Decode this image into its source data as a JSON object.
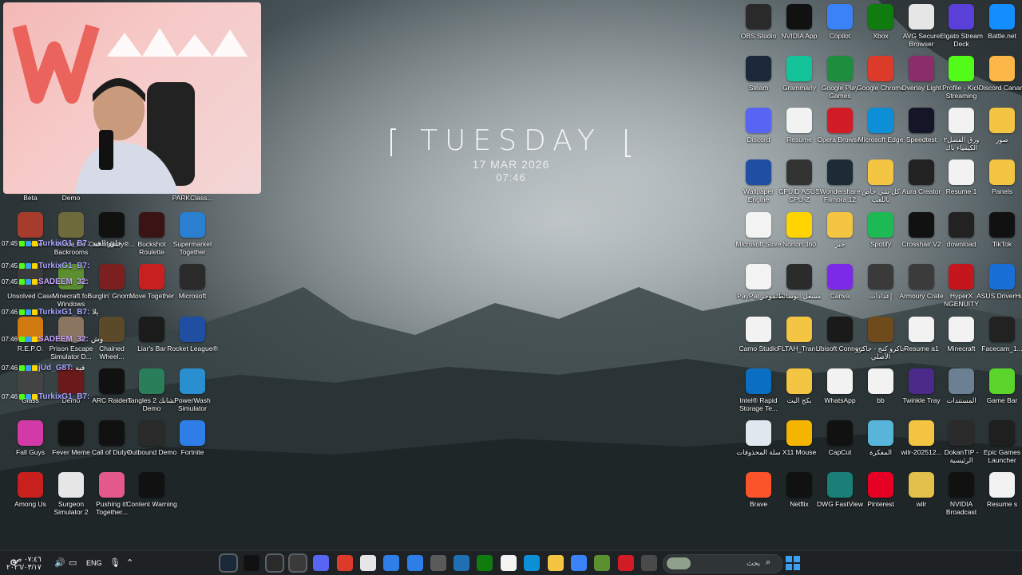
{
  "wallpaper": {
    "day": "TUESDAY",
    "date": "17 MAR 2026",
    "time": "07:46"
  },
  "desktop_icons_right": [
    {
      "label": "OBS Studio",
      "icon": "obs-icon",
      "color": "#2a2a2a"
    },
    {
      "label": "NVIDIA App",
      "icon": "nvidia-icon",
      "color": "#111111"
    },
    {
      "label": "Copilot",
      "icon": "copilot-icon",
      "color": "#3b82f6"
    },
    {
      "label": "Xbox",
      "icon": "xbox-icon",
      "color": "#107c10"
    },
    {
      "label": "AVG Secure Browser",
      "icon": "avg-browser-icon",
      "color": "#e6e6e6"
    },
    {
      "label": "Elgato Stream Deck",
      "icon": "stream-deck-icon",
      "color": "#5b3fd9"
    },
    {
      "label": "Battle.net",
      "icon": "battlenet-icon",
      "color": "#148eff"
    },
    {
      "label": "Steam",
      "icon": "steam-icon",
      "color": "#1b2838"
    },
    {
      "label": "Grammarly",
      "icon": "grammarly-icon",
      "color": "#15c39a"
    },
    {
      "label": "Google Play Games",
      "icon": "play-games-icon",
      "color": "#1e8e3e"
    },
    {
      "label": "Google Chrome",
      "icon": "chrome-icon",
      "color": "#dd3b2a"
    },
    {
      "label": "Overlay Light",
      "icon": "winrar-icon",
      "color": "#8b2d6b"
    },
    {
      "label": "Profile - Kick Streaming",
      "icon": "kick-icon",
      "color": "#53fc18"
    },
    {
      "label": "Discord Canary",
      "icon": "discord-canary-icon",
      "color": "#fbb848"
    },
    {
      "label": "Discord",
      "icon": "discord-icon",
      "color": "#5865f2"
    },
    {
      "label": "Resume",
      "icon": "document-icon",
      "color": "#f2f2f2"
    },
    {
      "label": "Opera Browser",
      "icon": "opera-icon",
      "color": "#d11b25"
    },
    {
      "label": "Microsoft Edge",
      "icon": "edge-icon",
      "color": "#0c8fd6"
    },
    {
      "label": "Speedtest",
      "icon": "speedtest-icon",
      "color": "#141526"
    },
    {
      "label": "ورق الفصل٢ الكيمياء باك",
      "icon": "pdf-icon",
      "color": "#f2f2f2"
    },
    {
      "label": "صور",
      "icon": "folder-icon",
      "color": "#f4c542"
    },
    {
      "label": "Wallpaper Engine",
      "icon": "wallpaper-engine-icon",
      "color": "#1f4ea3"
    },
    {
      "label": "CPUID ASUS CPU-Z",
      "icon": "cpuz-icon",
      "color": "#333333"
    },
    {
      "label": "Wondershare Filmora 12",
      "icon": "filmora-icon",
      "color": "#1d2b36"
    },
    {
      "label": "كل شي خاص باللعب",
      "icon": "folder-icon",
      "color": "#f4c542"
    },
    {
      "label": "Aura Creator",
      "icon": "aura-icon",
      "color": "#222222"
    },
    {
      "label": "Resume 1",
      "icon": "document-icon",
      "color": "#f2f2f2"
    },
    {
      "label": "Panels",
      "icon": "folder-icon",
      "color": "#f4c542"
    },
    {
      "label": "Microsoft Store",
      "icon": "store-icon",
      "color": "#f3f3f3"
    },
    {
      "label": "Norton 360",
      "icon": "norton-icon",
      "color": "#ffd400"
    },
    {
      "label": "جبر",
      "icon": "folder-icon",
      "color": "#f4c542"
    },
    {
      "label": "Spotify",
      "icon": "spotify-icon",
      "color": "#1db954"
    },
    {
      "label": "Crosshair V2",
      "icon": "crosshair-icon",
      "color": "#111111"
    },
    {
      "label": "download",
      "icon": "file-icon",
      "color": "#222222"
    },
    {
      "label": "TikTok",
      "icon": "tiktok-icon",
      "color": "#111111"
    },
    {
      "label": "PayPal الموجز",
      "icon": "paypal-icon",
      "color": "#f3f3f3"
    },
    {
      "label": "مشغل الوسائط",
      "icon": "media-player-icon",
      "color": "#2b2b2b"
    },
    {
      "label": "Canva",
      "icon": "canva-icon",
      "color": "#7d2ae8"
    },
    {
      "label": "إعدادات",
      "icon": "settings-icon",
      "color": "#3a3a3a"
    },
    {
      "label": "Armoury Crate",
      "icon": "armoury-icon",
      "color": "#3b3b3b"
    },
    {
      "label": "HyperX NGENUITY",
      "icon": "hyperx-icon",
      "color": "#c5161d"
    },
    {
      "label": "ASUS DriverHub",
      "icon": "asus-driverhub-icon",
      "color": "#1a6fd6"
    },
    {
      "label": "Camo Studio",
      "icon": "document-icon",
      "color": "#f2f2f2"
    },
    {
      "label": "FLTAH_Tran...",
      "icon": "zip-folder-icon",
      "color": "#f4c542"
    },
    {
      "label": "Ubisoft Connect",
      "icon": "ubisoft-icon",
      "color": "#1a1a1a"
    },
    {
      "label": "جاكرو كنج - جاكرو الأصلي",
      "icon": "game-icon",
      "color": "#6f4a1c"
    },
    {
      "label": "Resume a1",
      "icon": "document-icon",
      "color": "#f2f2f2"
    },
    {
      "label": "Minecraft",
      "icon": "document-icon",
      "color": "#f2f2f2"
    },
    {
      "label": "Facecam_1...",
      "icon": "file-icon",
      "color": "#222222"
    },
    {
      "label": "Intel® Rapid Storage Te...",
      "icon": "intel-icon",
      "color": "#0a6fc2"
    },
    {
      "label": "بكج البث",
      "icon": "folder-icon",
      "color": "#f4c542"
    },
    {
      "label": "WhatsApp",
      "icon": "document-icon",
      "color": "#f2f2f2"
    },
    {
      "label": "bb",
      "icon": "pdf-icon",
      "color": "#f2f2f2"
    },
    {
      "label": "Twinkle Tray",
      "icon": "twinkle-icon",
      "color": "#4b2a8a"
    },
    {
      "label": "المستندات",
      "icon": "documents-folder-icon",
      "color": "#6d7f93"
    },
    {
      "label": "Game Bar",
      "icon": "game-bar-icon",
      "color": "#5bd42b"
    },
    {
      "label": "سلة المحذوفات",
      "icon": "recycle-bin-icon",
      "color": "#dfe8ef"
    },
    {
      "label": "X11 Mouse",
      "icon": "mouse-icon",
      "color": "#f4b400"
    },
    {
      "label": "CapCut",
      "icon": "capcut-icon",
      "color": "#111111"
    },
    {
      "label": "المفكرة",
      "icon": "notepad-icon",
      "color": "#58b5d9"
    },
    {
      "label": "wilr-202512...",
      "icon": "folder-icon",
      "color": "#f4c542"
    },
    {
      "label": "DokanTIP - الرئيسية",
      "icon": "dokan-icon",
      "color": "#2a2a2a"
    },
    {
      "label": "Epic Games Launcher",
      "icon": "epic-icon",
      "color": "#1f1f1f"
    },
    {
      "label": "Brave",
      "icon": "brave-icon",
      "color": "#fb542b"
    },
    {
      "label": "Netflix",
      "icon": "netflix-icon",
      "color": "#111111"
    },
    {
      "label": "DWG FastView",
      "icon": "dwg-icon",
      "color": "#1a7f77"
    },
    {
      "label": "Pinterest",
      "icon": "pinterest-icon",
      "color": "#e60023"
    },
    {
      "label": "wilr",
      "icon": "winrar-archive-icon",
      "color": "#e3c04b"
    },
    {
      "label": "NVIDIA Broadcast",
      "icon": "nvidia-broadcast-icon",
      "color": "#111111"
    },
    {
      "label": "Resume s",
      "icon": "document-icon",
      "color": "#f2f2f2"
    }
  ],
  "desktop_icons_left": [
    {
      "label": "Beta",
      "icon": "game-icon",
      "color": "#333333"
    },
    {
      "label": "Demo",
      "icon": "game-icon",
      "color": "#333333"
    },
    {
      "label": "PARKClass...",
      "icon": "game-icon",
      "color": "#333333"
    },
    {
      "label": "To Drive",
      "icon": "game-icon",
      "color": "#a63c2b"
    },
    {
      "label": "Inside the Backrooms",
      "icon": "backrooms-icon",
      "color": "#6e6a3c"
    },
    {
      "label": "Call of Duty®...",
      "icon": "cod-icon",
      "color": "#111111"
    },
    {
      "label": "Buckshot Roulette",
      "icon": "buckshot-icon",
      "color": "#3a1414"
    },
    {
      "label": "Supermarket Together",
      "icon": "game-icon",
      "color": "#2a7fd1"
    },
    {
      "label": "Unsolved Case",
      "icon": "game-icon",
      "color": "#3b3b3b"
    },
    {
      "label": "Minecraft for Windows",
      "icon": "minecraft-icon",
      "color": "#5c8f2f"
    },
    {
      "label": "Burglin' Gnom...",
      "icon": "game-icon",
      "color": "#7c1f1f"
    },
    {
      "label": "Move Together",
      "icon": "game-icon",
      "color": "#c8201f"
    },
    {
      "label": "Microsoft",
      "icon": "game-icon",
      "color": "#2a2a2a"
    },
    {
      "label": "R.E.P.O.",
      "icon": "repo-icon",
      "color": "#d17a12"
    },
    {
      "label": "Prison Escape Simulator D...",
      "icon": "game-icon",
      "color": "#8a7560"
    },
    {
      "label": "Chained Wheel...",
      "icon": "game-icon",
      "color": "#5a4a2a"
    },
    {
      "label": "Liar's Bar",
      "icon": "liars-bar-icon",
      "color": "#1b1b1b"
    },
    {
      "label": "Rocket League®",
      "icon": "game-icon",
      "color": "#1f4ea3"
    },
    {
      "label": "Glass",
      "icon": "game-icon",
      "color": "#444444"
    },
    {
      "label": "Demo",
      "icon": "game-icon",
      "color": "#6a1a1a"
    },
    {
      "label": "ARC Raiders",
      "icon": "arc-icon",
      "color": "#111111"
    },
    {
      "label": "Tangles 2 تشابك Demo",
      "icon": "tangles-icon",
      "color": "#2a7f5a"
    },
    {
      "label": "PowerWash Simulator",
      "icon": "game-icon",
      "color": "#2a8fd1"
    },
    {
      "label": "Fall Guys",
      "icon": "fall-guys-icon",
      "color": "#d13aa7"
    },
    {
      "label": "Fever Meme",
      "icon": "fm-icon",
      "color": "#111111"
    },
    {
      "label": "Call of Duty®",
      "icon": "cod-icon",
      "color": "#111111"
    },
    {
      "label": "Outbound Demo",
      "icon": "outbound-icon",
      "color": "#2a2a2a"
    },
    {
      "label": "Fortnite",
      "icon": "fortnite-icon",
      "color": "#2f7ee8"
    },
    {
      "label": "Among Us",
      "icon": "among-us-icon",
      "color": "#c8201f"
    },
    {
      "label": "Surgeon Simulator 2",
      "icon": "game-icon",
      "color": "#e6e6e6"
    },
    {
      "label": "Pushing it! Together...",
      "icon": "game-icon",
      "color": "#e35a8a"
    },
    {
      "label": "Content Warning",
      "icon": "content-warning-icon",
      "color": "#111111"
    }
  ],
  "chat": [
    {
      "time": "07:45",
      "user": "TurkixG1_B7:",
      "message": "حلوو العبه"
    },
    {
      "time": "07:45",
      "user": "TurkixG1_B7:",
      "message": ""
    },
    {
      "time": "07:45",
      "user": "SADEEM_32:",
      "message": ""
    },
    {
      "time": "07:46",
      "user": "TurkixG1_B7:",
      "message": "يلا"
    },
    {
      "time": "07:46",
      "user": "SADEEM_32:",
      "message": "وش"
    },
    {
      "time": "07:46",
      "user": "jUd_G8T:",
      "message": "فيه"
    },
    {
      "time": "07:46",
      "user": "TurkixG1_B7:",
      "message": ""
    }
  ],
  "taskbar": {
    "search_placeholder": "بحث",
    "language": "ENG",
    "clock_time": "٠٧:٤٦ ص",
    "clock_date": "٢٠٢٦/٠٣/١٧",
    "apps": [
      {
        "icon": "steam-icon",
        "color": "#1b2838"
      },
      {
        "icon": "tiktok-icon",
        "color": "#111111"
      },
      {
        "icon": "obs-icon",
        "color": "#2a2a2a"
      },
      {
        "icon": "capcut-icon",
        "color": "#3a3a3a"
      },
      {
        "icon": "discord-icon",
        "color": "#5865f2"
      },
      {
        "icon": "chrome-icon",
        "color": "#dd3b2a"
      },
      {
        "icon": "avg-browser-icon",
        "color": "#e6e6e6"
      },
      {
        "icon": "photos-icon",
        "color": "#2f7ee8"
      },
      {
        "icon": "mail-icon",
        "color": "#2f7ee8"
      },
      {
        "icon": "settings-icon",
        "color": "#5a5a5a"
      },
      {
        "icon": "photos-icon",
        "color": "#1f6fb2"
      },
      {
        "icon": "xbox-icon",
        "color": "#107c10"
      },
      {
        "icon": "store-icon",
        "color": "#f3f3f3"
      },
      {
        "icon": "edge-icon",
        "color": "#0c8fd6"
      },
      {
        "icon": "file-explorer-icon",
        "color": "#f4c542"
      },
      {
        "icon": "copilot-icon",
        "color": "#3b82f6"
      },
      {
        "icon": "minecraft-icon",
        "color": "#5c8f2f"
      },
      {
        "icon": "opera-icon",
        "color": "#d11b25"
      },
      {
        "icon": "task-view-icon",
        "color": "#4a4a4a"
      }
    ]
  }
}
